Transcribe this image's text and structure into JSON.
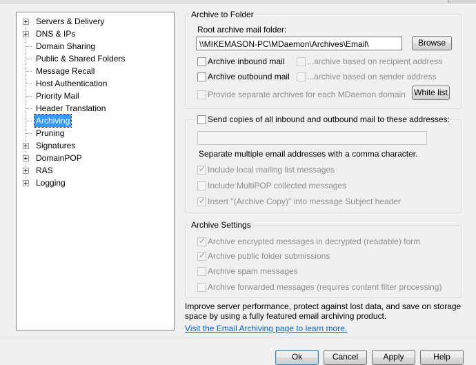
{
  "tree": {
    "items": [
      {
        "label": "Servers & Delivery",
        "expandable": true
      },
      {
        "label": "DNS & IPs",
        "expandable": true
      },
      {
        "label": "Domain Sharing",
        "expandable": false
      },
      {
        "label": "Public & Shared Folders",
        "expandable": false
      },
      {
        "label": "Message Recall",
        "expandable": false
      },
      {
        "label": "Host Authentication",
        "expandable": false
      },
      {
        "label": "Priority Mail",
        "expandable": false
      },
      {
        "label": "Header Translation",
        "expandable": false
      },
      {
        "label": "Archiving",
        "expandable": false,
        "selected": true
      },
      {
        "label": "Pruning",
        "expandable": false
      },
      {
        "label": "Signatures",
        "expandable": true
      },
      {
        "label": "DomainPOP",
        "expandable": true
      },
      {
        "label": "RAS",
        "expandable": true
      },
      {
        "label": "Logging",
        "expandable": true
      }
    ]
  },
  "archive_folder": {
    "title": "Archive to Folder",
    "root_label": "Root archive mail folder:",
    "root_value": "\\\\MIKEMASON-PC\\MDaemon\\Archives\\Email\\",
    "browse_label": "Browse",
    "inbound": {
      "label": "Archive inbound mail",
      "checked": false
    },
    "outbound": {
      "label": "Archive outbound mail",
      "checked": false
    },
    "recipient": {
      "label": "...archive based on recipient address",
      "checked": false
    },
    "sender": {
      "label": "...archive based on sender address",
      "checked": false
    },
    "separate": {
      "label": "Provide separate archives for each MDaemon domain",
      "checked": false
    },
    "whitelist_label": "White list"
  },
  "send_copies": {
    "label": "Send copies of all inbound and outbound mail to these addresses:",
    "checked": false,
    "addresses_value": "",
    "hint": "Separate multiple email addresses with a comma character.",
    "include_local": {
      "label": "Include local mailing list messages",
      "checked": true
    },
    "include_multipop": {
      "label": "Include MultiPOP collected messages",
      "checked": false
    },
    "insert_copy": {
      "label": "Insert \"(Archive Copy)\" into message Subject header",
      "checked": true
    }
  },
  "archive_settings": {
    "title": "Archive Settings",
    "encrypted": {
      "label": "Archive encrypted messages in decrypted (readable) form",
      "checked": true
    },
    "public_folder": {
      "label": "Archive public folder submissions",
      "checked": true
    },
    "spam": {
      "label": "Archive spam messages",
      "checked": false
    },
    "forwarded": {
      "label": "Archive forwarded messages (requires content filter processing)",
      "checked": false
    }
  },
  "info_text": "Improve server performance, protect against lost data, and save on storage space by using a fully featured email archiving product.",
  "link_text": "Visit the Email Archiving page to learn more.",
  "buttons": {
    "ok": "Ok",
    "cancel": "Cancel",
    "apply": "Apply",
    "help": "Help"
  }
}
